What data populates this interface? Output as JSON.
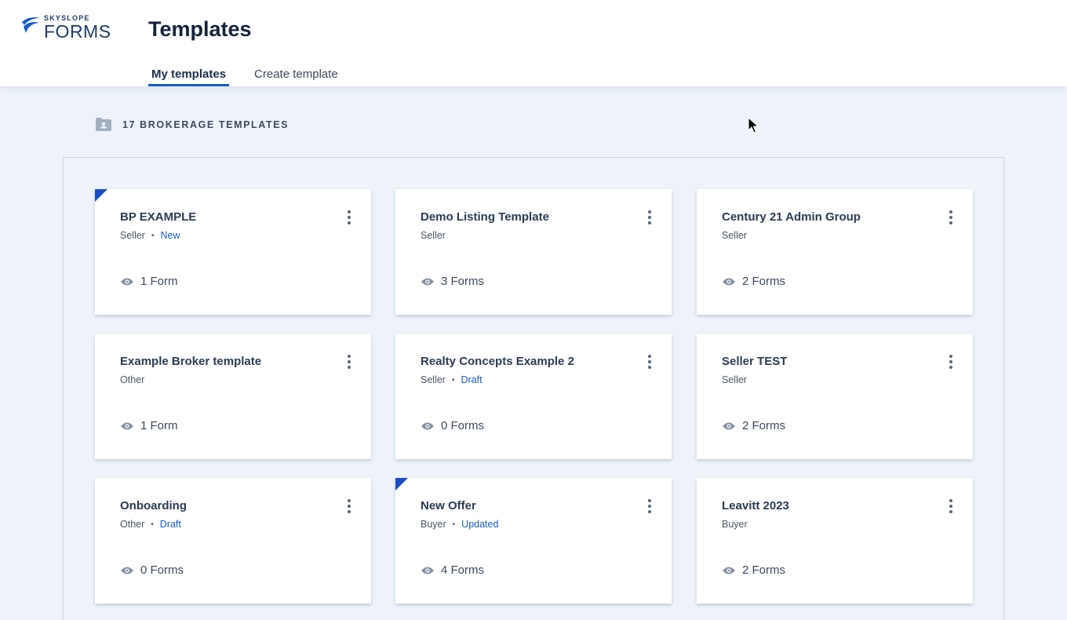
{
  "brand": {
    "small": "SKYSLOPE",
    "big": "FORMS",
    "accent": "#1a5cc8"
  },
  "header": {
    "title": "Templates"
  },
  "tabs": [
    {
      "label": "My templates",
      "active": true
    },
    {
      "label": "Create template",
      "active": false
    }
  ],
  "section": {
    "label": "17 BROKERAGE TEMPLATES",
    "icon": "folder-user-icon"
  },
  "cards": [
    {
      "title": "BP EXAMPLE",
      "type": "Seller",
      "status": "New",
      "forms": "1 Form",
      "flag": true
    },
    {
      "title": "Demo Listing Template",
      "type": "Seller",
      "status": "",
      "forms": "3 Forms",
      "flag": false
    },
    {
      "title": "Century 21 Admin Group",
      "type": "Seller",
      "status": "",
      "forms": "2 Forms",
      "flag": false
    },
    {
      "title": "Example Broker template",
      "type": "Other",
      "status": "",
      "forms": "1 Form",
      "flag": false
    },
    {
      "title": "Realty Concepts Example 2",
      "type": "Seller",
      "status": "Draft",
      "forms": "0 Forms",
      "flag": false
    },
    {
      "title": "Seller TEST",
      "type": "Seller",
      "status": "",
      "forms": "2 Forms",
      "flag": false
    },
    {
      "title": "Onboarding",
      "type": "Other",
      "status": "Draft",
      "forms": "0 Forms",
      "flag": false
    },
    {
      "title": "New Offer",
      "type": "Buyer",
      "status": "Updated",
      "forms": "4 Forms",
      "flag": true
    },
    {
      "title": "Leavitt 2023",
      "type": "Buyer",
      "status": "",
      "forms": "2 Forms",
      "flag": false
    }
  ]
}
